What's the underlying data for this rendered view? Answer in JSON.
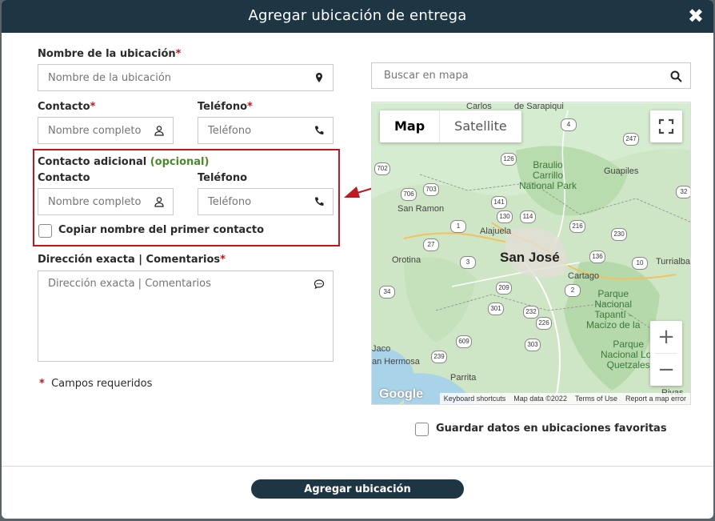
{
  "dialog": {
    "title": "Agregar ubicación de entrega",
    "close_label": "✖"
  },
  "form": {
    "location_name": {
      "label": "Nombre de la ubicación",
      "required_mark": "*",
      "placeholder": "Nombre de la ubicación"
    },
    "contact": {
      "label": "Contacto",
      "required_mark": "*",
      "placeholder": "Nombre completo"
    },
    "phone": {
      "label": "Teléfono",
      "required_mark": "*",
      "placeholder": "Teléfono"
    },
    "additional": {
      "heading": "Contacto adicional",
      "optional_tag": "(opcional)",
      "contact_label": "Contacto",
      "contact_placeholder": "Nombre completo",
      "phone_label": "Teléfono",
      "phone_placeholder": "Teléfono",
      "copy_checkbox_label": "Copiar nombre del primer contacto"
    },
    "address": {
      "label": "Dirección exacta | Comentarios",
      "required_mark": "*",
      "placeholder": "Dirección exacta | Comentarios"
    },
    "required_note_mark": "*",
    "required_note": "Campos requeridos"
  },
  "map": {
    "search_placeholder": "Buscar en mapa",
    "type_buttons": {
      "map": "Map",
      "satellite": "Satellite"
    },
    "zoom_in": "+",
    "zoom_out": "−",
    "attribution": {
      "shortcuts": "Keyboard shortcuts",
      "data": "Map data ©2022",
      "terms": "Terms of Use",
      "report": "Report a map error"
    },
    "google_logo": "Google",
    "labels": {
      "carlos": "Carlos",
      "sarapiqui": "de Sarapiqui",
      "braulio": "Braulio",
      "carrillo": "Carrillo",
      "national_park": "National Park",
      "guapiles": "Guapiles",
      "san_ramon": "San Ramon",
      "alajuela": "Alajuela",
      "san_jose": "San José",
      "orotina": "Orotina",
      "turrialba": "Turrialba",
      "cartago": "Cartago",
      "parque": "Parque",
      "nacional": "Nacional",
      "tapanti": "Tapantí -",
      "macizo": "Macizo de la",
      "parque2": "Parque",
      "nacional_los": "Nacional Los",
      "quetzales": "Quetzales",
      "jaco": "Jaco",
      "hermosa": "an Hermosa",
      "parrita": "Parrita",
      "rivas": "Rivas"
    },
    "shields": [
      "4",
      "126",
      "247",
      "32",
      "702",
      "703",
      "706",
      "141",
      "130",
      "114",
      "1",
      "216",
      "27",
      "3",
      "136",
      "10",
      "230",
      "2",
      "209",
      "34",
      "301",
      "232",
      "226",
      "239",
      "609",
      "303",
      "2",
      "4",
      "32"
    ]
  },
  "favorites_checkbox_label": "Guardar datos en ubicaciones favoritas",
  "submit_label": "Agregar ubicación",
  "colors": {
    "header": "#1e3544",
    "required": "#c0161e",
    "optional": "#4a8a2a",
    "callout": "#c0161e"
  }
}
